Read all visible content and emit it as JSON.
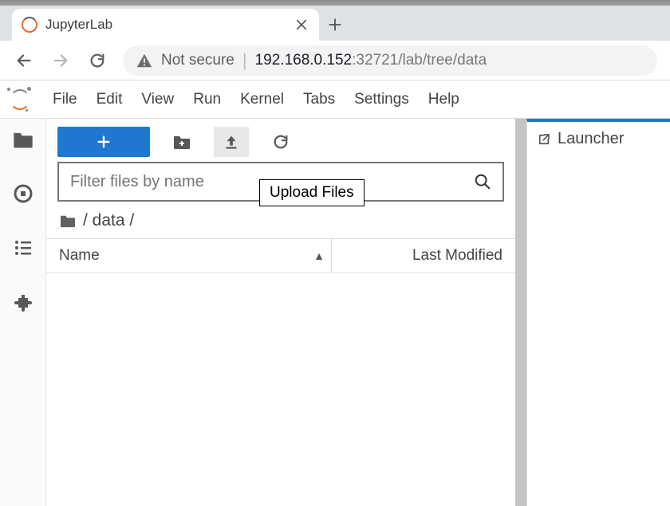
{
  "browser": {
    "tab_title": "JupyterLab",
    "security_label": "Not secure",
    "url_host": "192.168.0.152",
    "url_port_path": ":32721/lab/tree/data"
  },
  "menubar": [
    "File",
    "Edit",
    "View",
    "Run",
    "Kernel",
    "Tabs",
    "Settings",
    "Help"
  ],
  "filebrowser": {
    "tooltip": "Upload Files",
    "filter_placeholder": "Filter files by name",
    "breadcrumb": " / data / ",
    "col_name": "Name",
    "col_modified": "Last Modified"
  },
  "launcher": {
    "tab_label": "Launcher"
  }
}
